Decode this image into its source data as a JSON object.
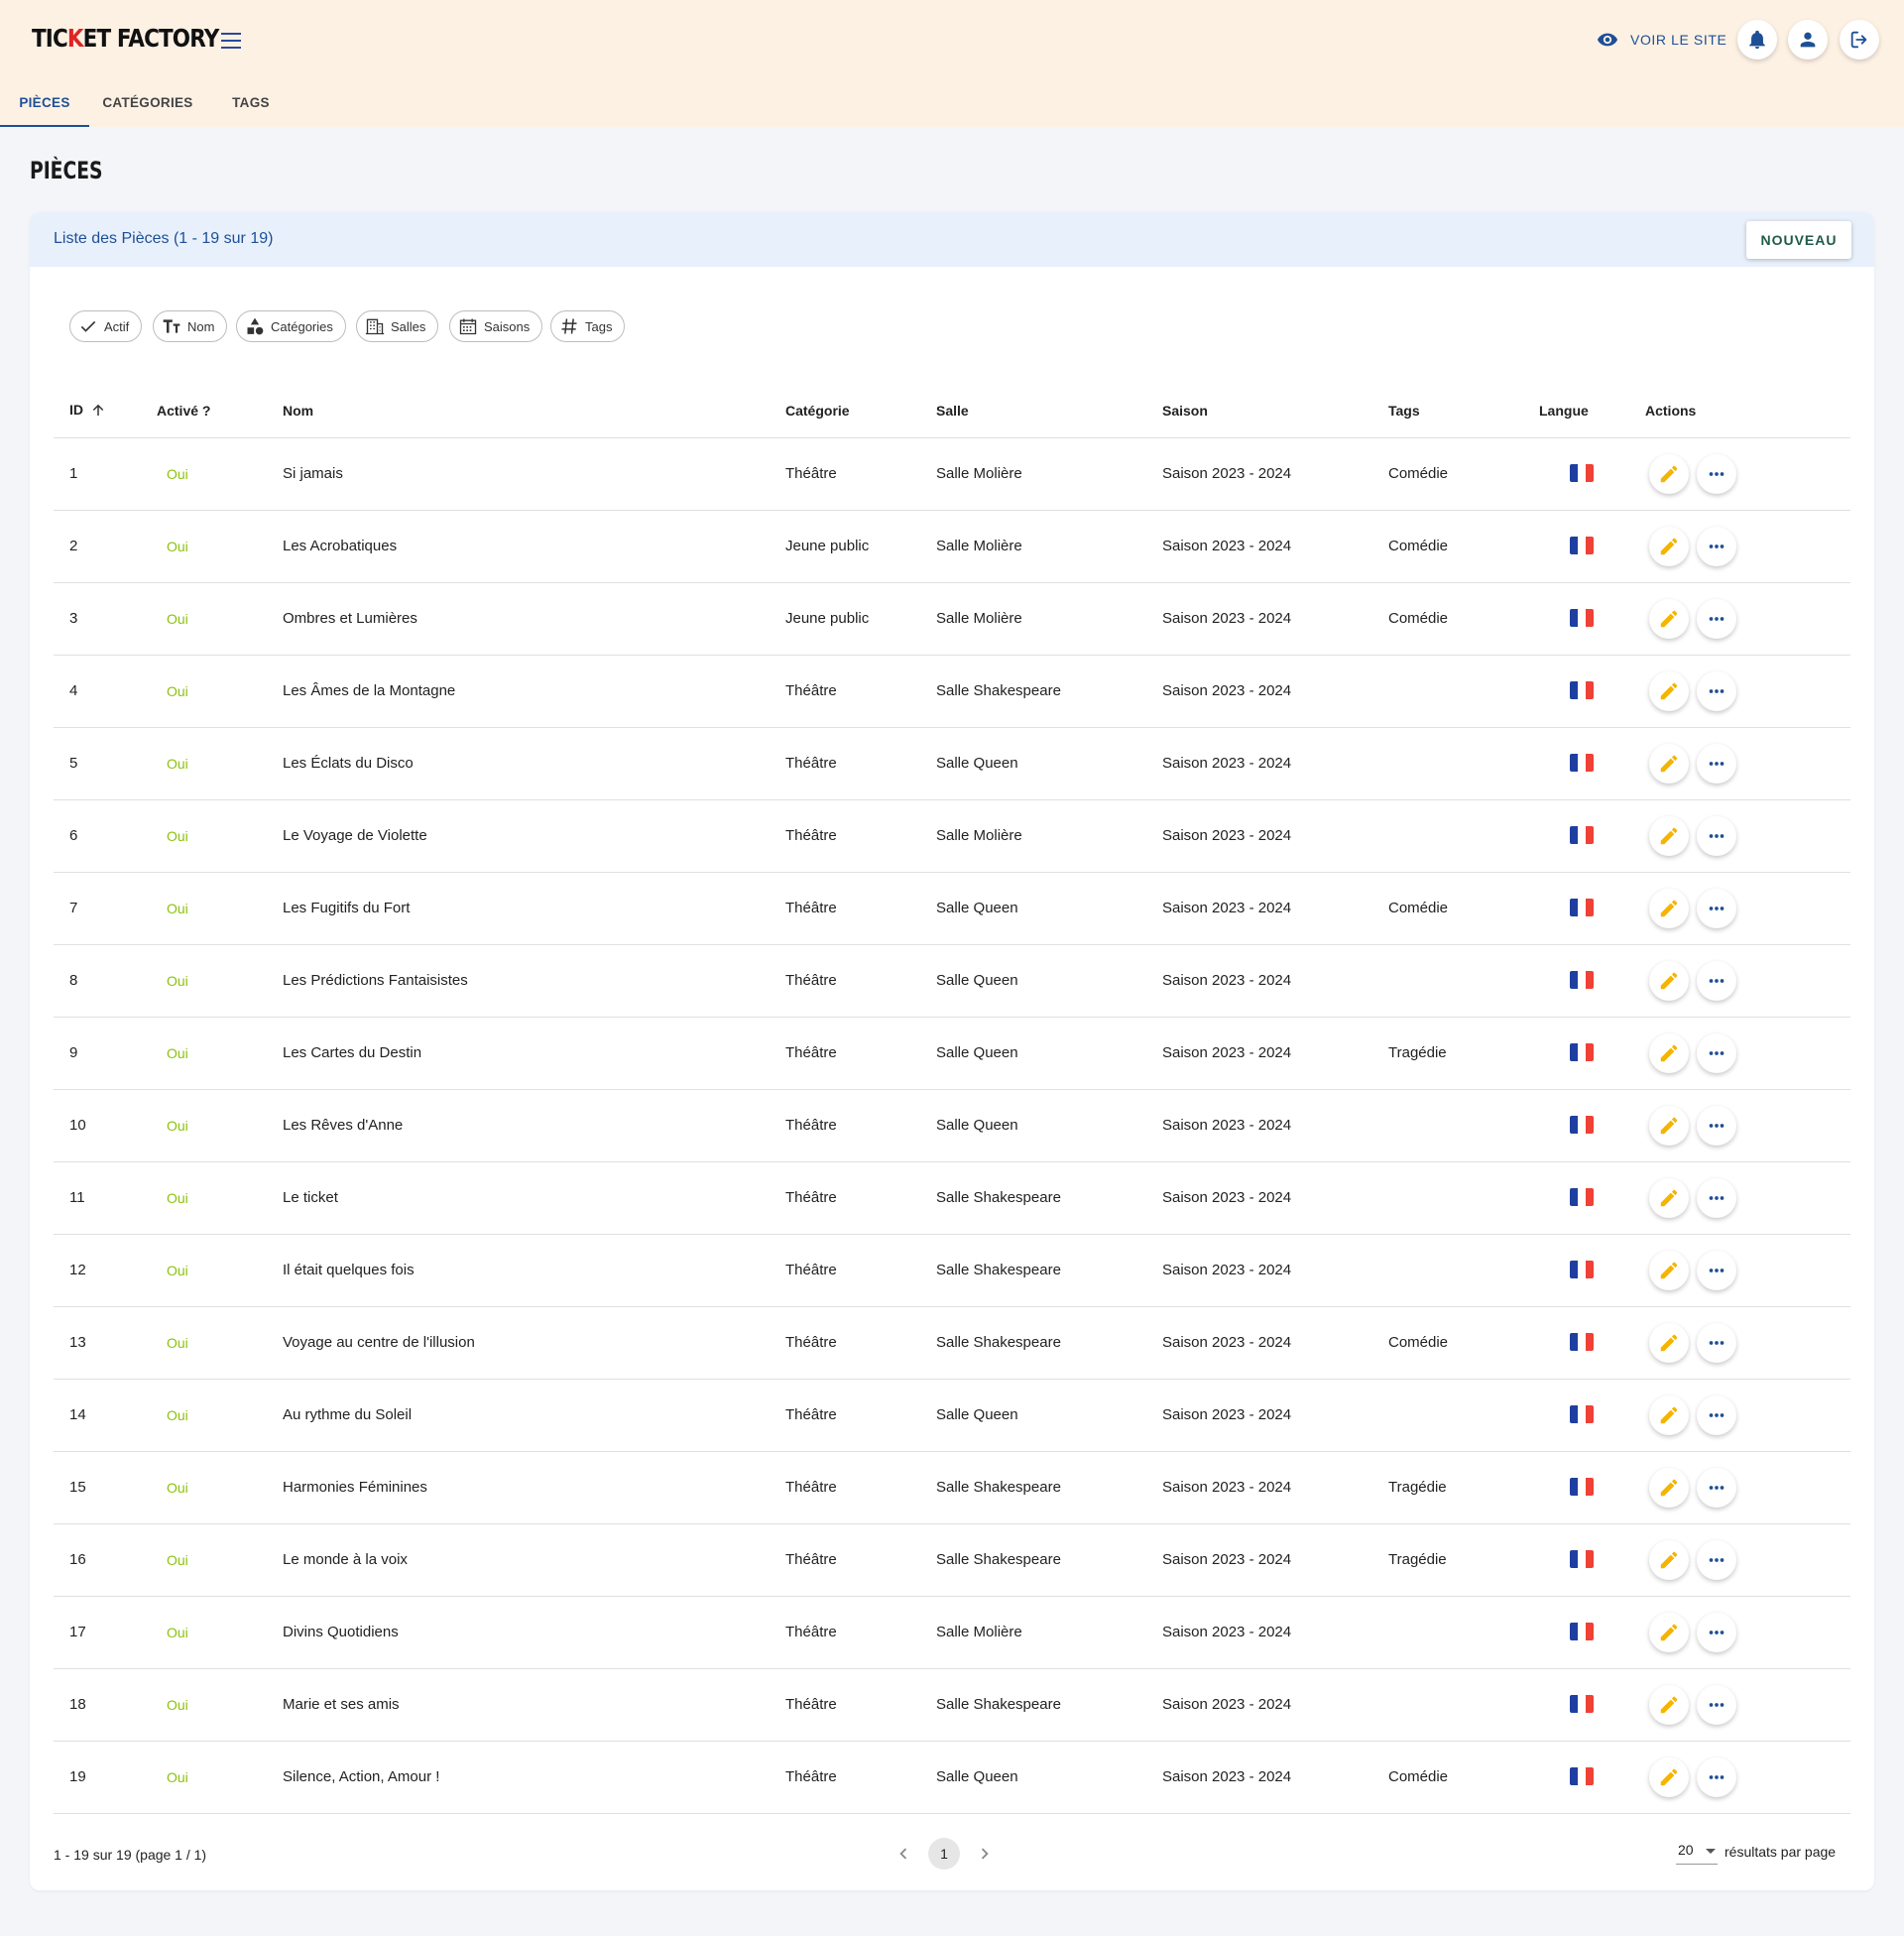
{
  "app": {
    "logo_left": "TIC",
    "logo_x": "K",
    "logo_right": "ET FACTORY",
    "voir_site": "VOIR LE SITE"
  },
  "tabs": [
    "PIÈCES",
    "CATÉGORIES",
    "TAGS"
  ],
  "page_title": "PIÈCES",
  "list": {
    "title": "Liste des Pièces (1 - 19 sur 19)",
    "new_button": "NOUVEAU"
  },
  "filters": [
    "Actif",
    "Nom",
    "Catégories",
    "Salles",
    "Saisons",
    "Tags"
  ],
  "columns": {
    "id": "ID",
    "active": "Activé ?",
    "name": "Nom",
    "category": "Catégorie",
    "room": "Salle",
    "season": "Saison",
    "tags": "Tags",
    "language": "Langue",
    "actions": "Actions"
  },
  "rows": [
    {
      "id": "1",
      "active": "Oui",
      "name": "Si jamais",
      "category": "Théâtre",
      "room": "Salle Molière",
      "season": "Saison 2023 - 2024",
      "tags": "Comédie",
      "language": "fr"
    },
    {
      "id": "2",
      "active": "Oui",
      "name": "Les Acrobatiques",
      "category": "Jeune public",
      "room": "Salle Molière",
      "season": "Saison 2023 - 2024",
      "tags": "Comédie",
      "language": "fr"
    },
    {
      "id": "3",
      "active": "Oui",
      "name": "Ombres et Lumières",
      "category": "Jeune public",
      "room": "Salle Molière",
      "season": "Saison 2023 - 2024",
      "tags": "Comédie",
      "language": "fr"
    },
    {
      "id": "4",
      "active": "Oui",
      "name": "Les Âmes de la Montagne",
      "category": "Théâtre",
      "room": "Salle Shakespeare",
      "season": "Saison 2023 - 2024",
      "tags": "",
      "language": "fr"
    },
    {
      "id": "5",
      "active": "Oui",
      "name": "Les Éclats du Disco",
      "category": "Théâtre",
      "room": "Salle Queen",
      "season": "Saison 2023 - 2024",
      "tags": "",
      "language": "fr"
    },
    {
      "id": "6",
      "active": "Oui",
      "name": "Le Voyage de Violette",
      "category": "Théâtre",
      "room": "Salle Molière",
      "season": "Saison 2023 - 2024",
      "tags": "",
      "language": "fr"
    },
    {
      "id": "7",
      "active": "Oui",
      "name": "Les Fugitifs du Fort",
      "category": "Théâtre",
      "room": "Salle Queen",
      "season": "Saison 2023 - 2024",
      "tags": "Comédie",
      "language": "fr"
    },
    {
      "id": "8",
      "active": "Oui",
      "name": "Les Prédictions Fantaisistes",
      "category": "Théâtre",
      "room": "Salle Queen",
      "season": "Saison 2023 - 2024",
      "tags": "",
      "language": "fr"
    },
    {
      "id": "9",
      "active": "Oui",
      "name": "Les Cartes du Destin",
      "category": "Théâtre",
      "room": "Salle Queen",
      "season": "Saison 2023 - 2024",
      "tags": "Tragédie",
      "language": "fr"
    },
    {
      "id": "10",
      "active": "Oui",
      "name": "Les Rêves d'Anne",
      "category": "Théâtre",
      "room": "Salle Queen",
      "season": "Saison 2023 - 2024",
      "tags": "",
      "language": "fr"
    },
    {
      "id": "11",
      "active": "Oui",
      "name": "Le ticket",
      "category": "Théâtre",
      "room": "Salle Shakespeare",
      "season": "Saison 2023 - 2024",
      "tags": "",
      "language": "fr"
    },
    {
      "id": "12",
      "active": "Oui",
      "name": "Il était quelques fois",
      "category": "Théâtre",
      "room": "Salle Shakespeare",
      "season": "Saison 2023 - 2024",
      "tags": "",
      "language": "fr"
    },
    {
      "id": "13",
      "active": "Oui",
      "name": "Voyage au centre de l'illusion",
      "category": "Théâtre",
      "room": "Salle Shakespeare",
      "season": "Saison 2023 - 2024",
      "tags": "Comédie",
      "language": "fr"
    },
    {
      "id": "14",
      "active": "Oui",
      "name": "Au rythme du Soleil",
      "category": "Théâtre",
      "room": "Salle Queen",
      "season": "Saison 2023 - 2024",
      "tags": "",
      "language": "fr"
    },
    {
      "id": "15",
      "active": "Oui",
      "name": "Harmonies Féminines",
      "category": "Théâtre",
      "room": "Salle Shakespeare",
      "season": "Saison 2023 - 2024",
      "tags": "Tragédie",
      "language": "fr"
    },
    {
      "id": "16",
      "active": "Oui",
      "name": "Le monde à la voix",
      "category": "Théâtre",
      "room": "Salle Shakespeare",
      "season": "Saison 2023 - 2024",
      "tags": "Tragédie",
      "language": "fr"
    },
    {
      "id": "17",
      "active": "Oui",
      "name": "Divins Quotidiens",
      "category": "Théâtre",
      "room": "Salle Molière",
      "season": "Saison 2023 - 2024",
      "tags": "",
      "language": "fr"
    },
    {
      "id": "18",
      "active": "Oui",
      "name": "Marie et ses amis",
      "category": "Théâtre",
      "room": "Salle Shakespeare",
      "season": "Saison 2023 - 2024",
      "tags": "",
      "language": "fr"
    },
    {
      "id": "19",
      "active": "Oui",
      "name": "Silence, Action, Amour !",
      "category": "Théâtre",
      "room": "Salle Queen",
      "season": "Saison 2023 - 2024",
      "tags": "Comédie",
      "language": "fr"
    }
  ],
  "footer": {
    "info": "1 - 19 sur 19 (page 1 / 1)",
    "current_page": "1",
    "per_page_value": "20",
    "per_page_label": "résultats par page"
  },
  "colors": {
    "header_bg": "#fdf1e4",
    "primary_blue": "#1e4f96",
    "active_green": "#8cc20d",
    "edit_orange": "#f4b400",
    "flag_blue": "#1f3fa0",
    "flag_red": "#ef4135"
  },
  "icons": {
    "voir_site": "eye-icon",
    "notifications": "bell-icon",
    "account": "user-icon",
    "logout": "logout-icon",
    "menu": "menu-icon",
    "edit": "pencil-icon",
    "more": "more-horizontal-icon",
    "sort": "arrow-up-icon",
    "language": "france-flag-icon"
  }
}
